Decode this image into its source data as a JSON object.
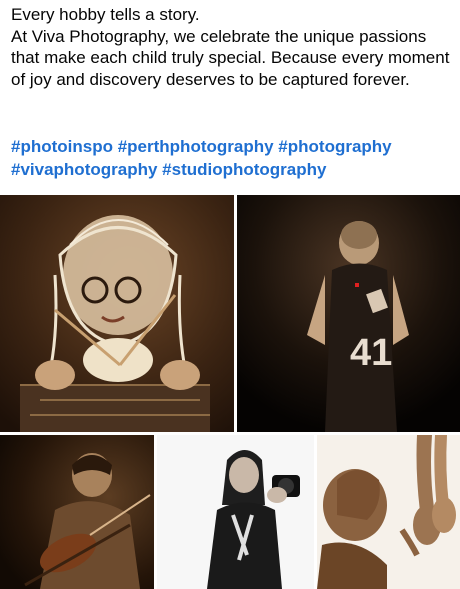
{
  "post": {
    "caption_lines": [
      "Every hobby tells a story.",
      "At Viva Photography, we celebrate the unique passions that make each child truly special. Because every moment of joy and discovery deserves to be captured forever."
    ],
    "hashtags": [
      "#photoinspo",
      "#perthphotography",
      "#photography",
      "#vivaphotography",
      "#studiophotography"
    ],
    "jersey_number": "41"
  },
  "colors": {
    "hashtag": "#1f6fd1",
    "text": "#050505",
    "sepia_dark": "#2a1a0e",
    "sepia_light": "#c9a27a"
  }
}
